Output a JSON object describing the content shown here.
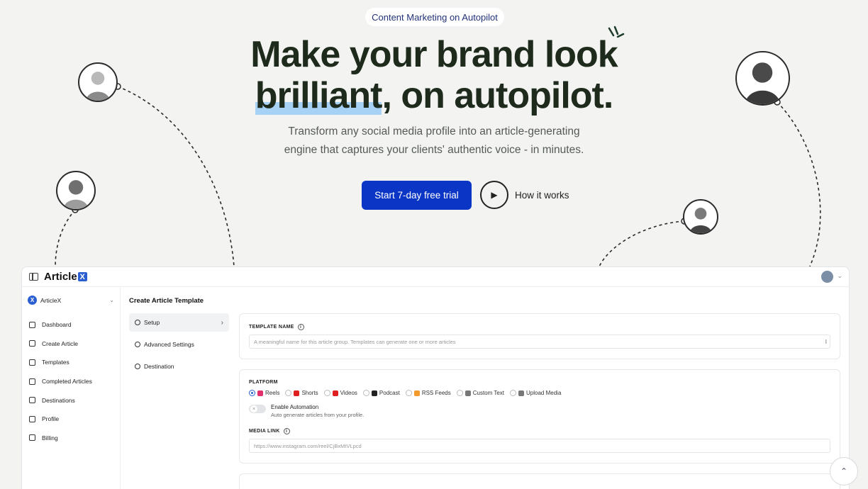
{
  "hero": {
    "badge": "Content Marketing on Autopilot",
    "title_line1": "Make your brand look",
    "title_highlight": "brilliant",
    "title_line2_rest": ", on autopilot.",
    "subtitle_line1": "Transform any social media profile into an article-generating",
    "subtitle_line2": "engine that captures your clients' authentic voice - in minutes.",
    "cta_primary": "Start 7-day free trial",
    "cta_secondary": "How it works",
    "play_icon": "▶"
  },
  "colors": {
    "primary": "#0b36c5",
    "highlight": "#a8d2f5",
    "brand_blue": "#2b5fd1"
  },
  "app": {
    "brand": "Article",
    "brand_badge": "X",
    "workspace": "ArticleX",
    "nav": [
      {
        "label": "Dashboard",
        "icon": "dashboard-icon"
      },
      {
        "label": "Create Article",
        "icon": "document-icon"
      },
      {
        "label": "Templates",
        "icon": "sliders-icon"
      },
      {
        "label": "Completed Articles",
        "icon": "document-check-icon"
      },
      {
        "label": "Destinations",
        "icon": "destination-icon"
      },
      {
        "label": "Profile",
        "icon": "user-icon"
      },
      {
        "label": "Billing",
        "icon": "card-icon"
      }
    ],
    "page_title": "Create Article Template",
    "steps": [
      {
        "label": "Setup",
        "icon": "sliders-icon",
        "active": true
      },
      {
        "label": "Advanced Settings",
        "icon": "gear-icon",
        "active": false
      },
      {
        "label": "Destination",
        "icon": "destination-icon",
        "active": false
      }
    ],
    "template_name": {
      "label": "TEMPLATE NAME",
      "placeholder": "A meaningful name for this article group. Templates can generate one or more articles"
    },
    "platform": {
      "label": "PLATFORM",
      "options": [
        {
          "label": "Reels",
          "color": "#e1306c",
          "selected": true
        },
        {
          "label": "Shorts",
          "color": "#e02020",
          "selected": false
        },
        {
          "label": "Videos",
          "color": "#e02020",
          "selected": false
        },
        {
          "label": "Podcast",
          "color": "#222222",
          "selected": false
        },
        {
          "label": "RSS Feeds",
          "color": "#f29a2e",
          "selected": false
        },
        {
          "label": "Custom Text",
          "color": "#777777",
          "selected": false
        },
        {
          "label": "Upload Media",
          "color": "#777777",
          "selected": false
        }
      ]
    },
    "automation": {
      "title": "Enable Automation",
      "description": "Auto generate articles from your profile."
    },
    "media_link": {
      "label": "MEDIA LINK",
      "placeholder": "https://www.instagram.com/reel/CjBxMtVLpcd"
    }
  }
}
